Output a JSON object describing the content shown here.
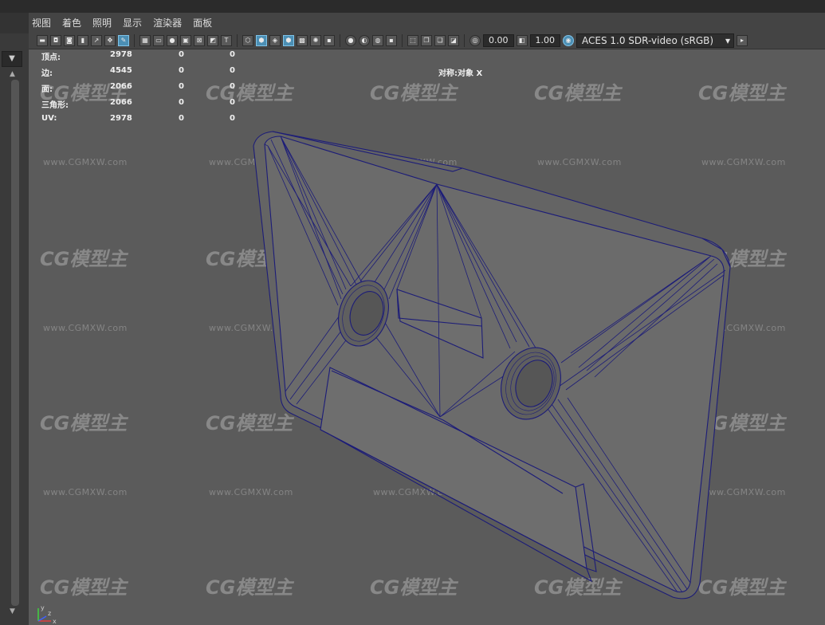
{
  "menus": [
    "视图",
    "着色",
    "照明",
    "显示",
    "渲染器",
    "面板"
  ],
  "toolbar": {
    "exposure_value": "0.00",
    "gamma_value": "1.00",
    "color_space": "ACES 1.0 SDR-video (sRGB)",
    "colors": {
      "accent_active": "#4c8fb4",
      "wire": "#1c1c78"
    }
  },
  "hud": {
    "stats": [
      {
        "label": "顶点:",
        "values": [
          "2978",
          "0",
          "0"
        ]
      },
      {
        "label": "边:",
        "values": [
          "4545",
          "0",
          "0"
        ]
      },
      {
        "label": "面:",
        "values": [
          "2066",
          "0",
          "0"
        ]
      },
      {
        "label": "三角形:",
        "values": [
          "2066",
          "0",
          "0"
        ]
      },
      {
        "label": "UV:",
        "values": [
          "2978",
          "0",
          "0"
        ]
      }
    ],
    "symmetry": "对称:对象 X"
  },
  "camera": "persp",
  "axes": {
    "x": "x",
    "y": "y",
    "z": "z"
  },
  "watermark": {
    "logo": "CG模型主",
    "url": "www.CGMXW.com"
  },
  "left_panel": {
    "dropdown": "▼"
  }
}
